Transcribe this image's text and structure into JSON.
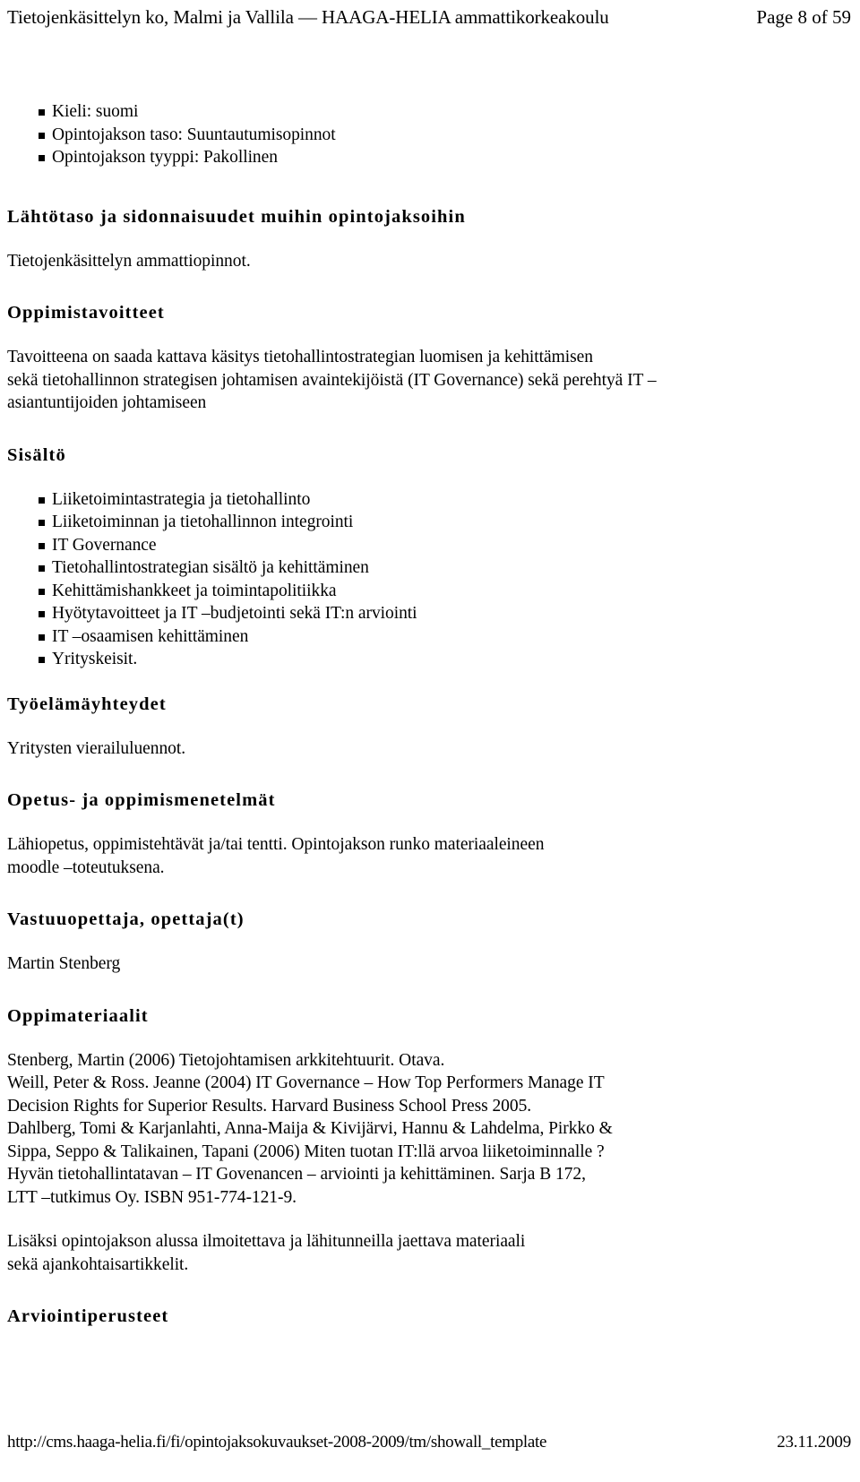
{
  "header": {
    "title": "Tietojenkäsittelyn ko, Malmi ja Vallila — HAAGA-HELIA ammattikorkeakoulu",
    "page_label": "Page 8 of 59"
  },
  "top_list": {
    "items": [
      "Kieli: suomi",
      "Opintojakson taso: Suuntautumisopinnot",
      "Opintojakson tyyppi: Pakollinen"
    ]
  },
  "sections": {
    "prerequisites": {
      "heading": "Lähtötaso ja sidonnaisuudet muihin opintojaksoihin",
      "body": "Tietojenkäsittelyn ammattiopinnot."
    },
    "objectives": {
      "heading": "Oppimistavoitteet",
      "body_line1": "Tavoitteena on saada kattava käsitys tietohallintostrategian luomisen ja kehittämisen",
      "body_line2": "sekä tietohallinnon strategisen johtamisen avaintekijöistä (IT Governance) sekä perehtyä IT –",
      "body_line3": "asiantuntijoiden johtamiseen"
    },
    "contents": {
      "heading": "Sisältö",
      "items": [
        "Liiketoimintastrategia ja tietohallinto",
        "Liiketoiminnan ja tietohallinnon integrointi",
        "IT Governance",
        "Tietohallintostrategian sisältö ja kehittäminen",
        "Kehittämishankkeet ja toimintapolitiikka",
        "Hyötytavoitteet ja IT –budjetointi sekä IT:n arviointi",
        "IT –osaamisen kehittäminen",
        "Yrityskeisit."
      ]
    },
    "working_life": {
      "heading": "Työelämäyhteydet",
      "body": "Yritysten vierailuluennot."
    },
    "methods": {
      "heading": "Opetus- ja oppimismenetelmät",
      "body_line1": "Lähiopetus, oppimistehtävät ja/tai tentti. Opintojakson runko materiaaleineen",
      "body_line2": "moodle –toteutuksena."
    },
    "teacher": {
      "heading": "Vastuuopettaja, opettaja(t)",
      "body": "Martin Stenberg"
    },
    "materials": {
      "heading": "Oppimateriaalit",
      "references": [
        "Stenberg, Martin (2006) Tietojohtamisen arkkitehtuurit. Otava.",
        "Weill, Peter & Ross. Jeanne (2004) IT Governance – How Top Performers Manage IT",
        "Decision Rights for Superior Results. Harvard Business School Press 2005.",
        "Dahlberg, Tomi & Karjanlahti, Anna-Maija & Kivijärvi, Hannu & Lahdelma, Pirkko &",
        "Sippa, Seppo & Talikainen, Tapani (2006) Miten tuotan IT:llä arvoa liiketoiminnalle ?",
        "Hyvän tietohallintatavan – IT Govenancen – arviointi ja kehittäminen. Sarja B 172,",
        "LTT –tutkimus Oy. ISBN 951-774-121-9."
      ],
      "note_line1": "Lisäksi opintojakson alussa ilmoitettava ja lähitunneilla jaettava materiaali",
      "note_line2": "sekä ajankohtaisartikkelit."
    },
    "assessment": {
      "heading": "Arviointiperusteet"
    }
  },
  "footer": {
    "url": "http://cms.haaga-helia.fi/fi/opintojaksokuvaukset-2008-2009/tm/showall_template",
    "date": "23.11.2009"
  }
}
